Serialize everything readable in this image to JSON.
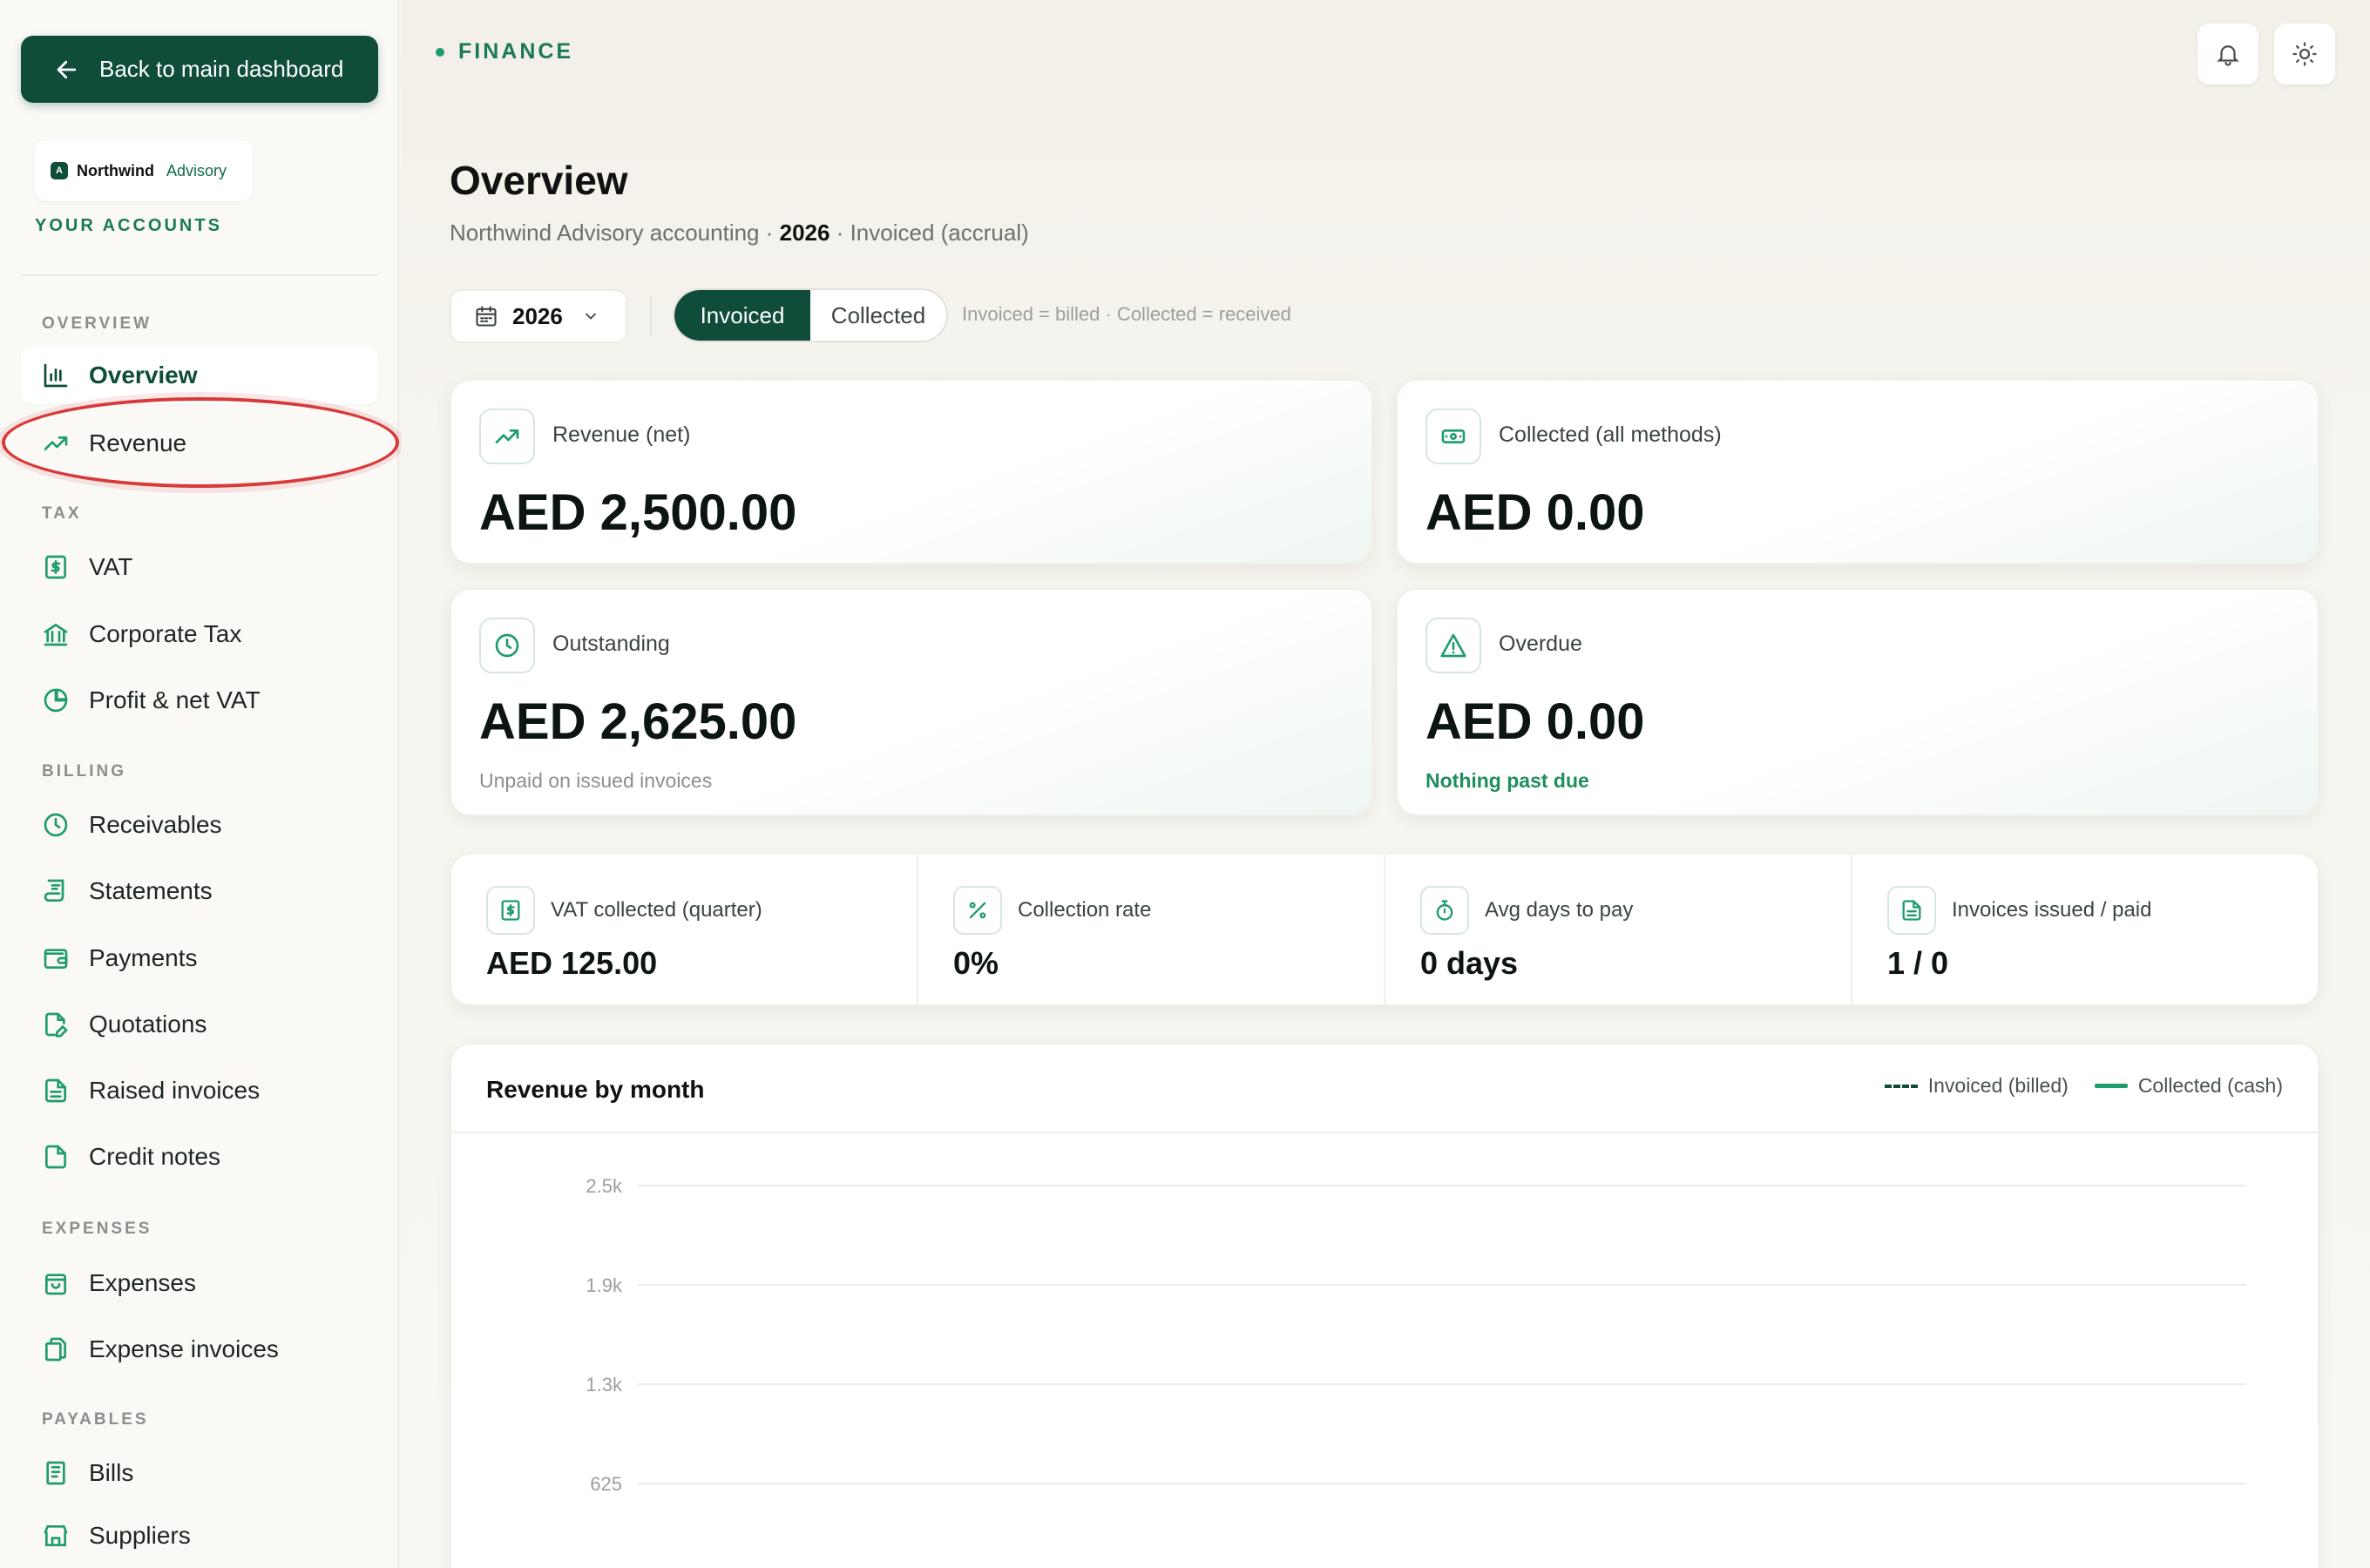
{
  "sidebar": {
    "back_label": "Back to main dashboard",
    "brand": {
      "mark": "A",
      "name": "Northwind",
      "sub": "Advisory"
    },
    "your_accounts": "YOUR ACCOUNTS",
    "sections": {
      "overview": "OVERVIEW",
      "tax": "TAX",
      "billing": "BILLING",
      "expenses": "EXPENSES",
      "payables": "PAYABLES"
    },
    "items": {
      "overview": "Overview",
      "revenue": "Revenue",
      "vat": "VAT",
      "corporate_tax": "Corporate Tax",
      "profit_vat": "Profit & net VAT",
      "receivables": "Receivables",
      "statements": "Statements",
      "payments": "Payments",
      "quotations": "Quotations",
      "raised_invoices": "Raised invoices",
      "credit_notes": "Credit notes",
      "expenses": "Expenses",
      "expense_invoices": "Expense invoices",
      "bills": "Bills",
      "suppliers": "Suppliers"
    }
  },
  "header": {
    "crumb": "FINANCE",
    "title": "Overview",
    "subtitle_pre": "Northwind Advisory accounting · ",
    "subtitle_year": "2026",
    "subtitle_post": " · Invoiced (accrual)"
  },
  "filters": {
    "year": "2026",
    "toggle_on": "Invoiced",
    "toggle_off": "Collected",
    "hint": "Invoiced = billed · Collected = received"
  },
  "cards": {
    "revenue": {
      "label": "Revenue (net)",
      "value": "AED 2,500.00"
    },
    "collected": {
      "label": "Collected (all methods)",
      "value": "AED 0.00"
    },
    "outstanding": {
      "label": "Outstanding",
      "value": "AED 2,625.00",
      "note": "Unpaid on issued invoices"
    },
    "overdue": {
      "label": "Overdue",
      "value": "AED 0.00",
      "note": "Nothing past due"
    }
  },
  "stats": {
    "vat": {
      "label": "VAT collected (quarter)",
      "value": "AED 125.00"
    },
    "rate": {
      "label": "Collection rate",
      "value": "0%"
    },
    "days": {
      "label": "Avg days to pay",
      "value": "0 days"
    },
    "issued": {
      "label": "Invoices issued / paid",
      "value": "1 / 0"
    }
  },
  "chart_data": {
    "type": "line",
    "title": "Revenue by month",
    "series": [
      {
        "name": "Invoiced (billed)",
        "values": [],
        "color": "#0f4c3a",
        "style": "dashed"
      },
      {
        "name": "Collected (cash)",
        "values": [],
        "color": "#1f9c6b",
        "style": "solid"
      }
    ],
    "y_ticks": [
      "2.5k",
      "1.9k",
      "1.3k",
      "625"
    ],
    "ylim": [
      0,
      2500
    ],
    "grid": true,
    "legend_position": "top-right"
  },
  "colors": {
    "brand": "#0f4c3a",
    "accent": "#1f9c6b",
    "highlight": "#d63a3a"
  }
}
